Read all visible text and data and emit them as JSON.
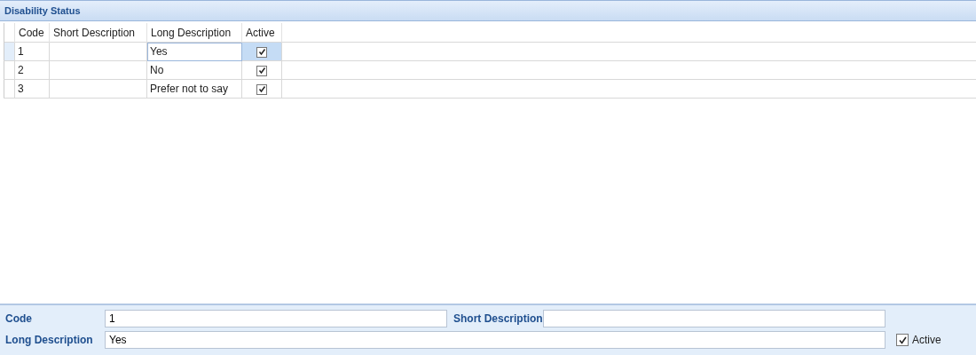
{
  "window": {
    "title": "Disability Status"
  },
  "table": {
    "columns": [
      "Code",
      "Short Description",
      "Long Description",
      "Active"
    ],
    "rows": [
      {
        "code": "1",
        "long_description": "Yes",
        "active": true,
        "selected": true
      },
      {
        "code": "2",
        "long_description": "No",
        "active": true,
        "selected": false
      },
      {
        "code": "3",
        "long_description": "Prefer not to say",
        "active": true,
        "selected": false
      }
    ]
  },
  "form": {
    "code_label": "Code",
    "code_value": "1",
    "short_label": "Short Description",
    "long_label": "Long Description",
    "long_value": "Yes",
    "active_label": "Active",
    "active": true
  }
}
